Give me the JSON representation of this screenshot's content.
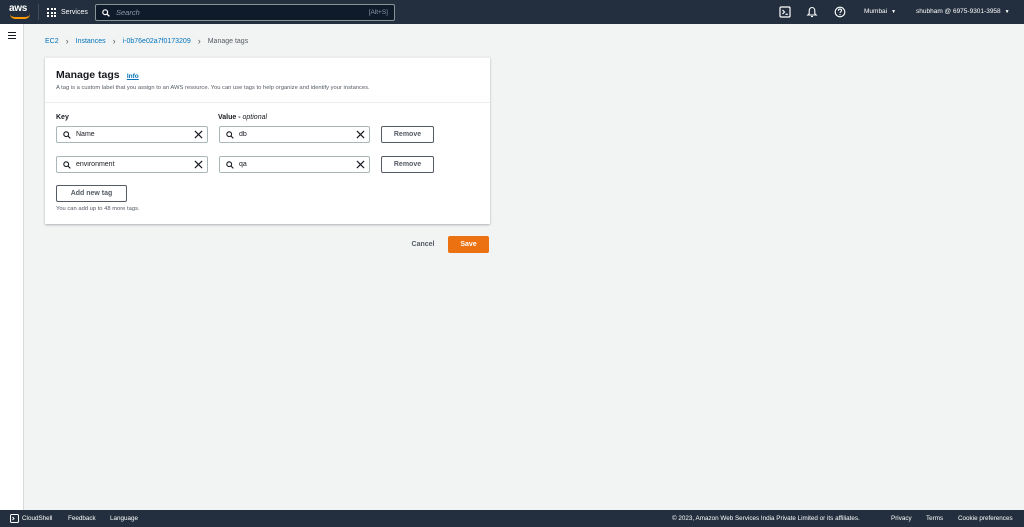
{
  "nav": {
    "logo": "aws",
    "services_label": "Services",
    "search_placeholder": "Search",
    "search_shortcut": "[Alt+S]",
    "region": "Mumbai",
    "account": "shubham @ 6975-9301-3958",
    "icons": [
      "cloudshell-icon",
      "bell-icon",
      "help-icon"
    ]
  },
  "breadcrumb": {
    "items": [
      "EC2",
      "Instances",
      "i-0b76e02a7f0173209"
    ],
    "current": "Manage tags"
  },
  "panel": {
    "title": "Manage tags",
    "info": "Info",
    "description": "A tag is a custom label that you assign to an AWS resource. You can use tags to help organize and identify your instances.",
    "key_label": "Key",
    "value_label": "Value - ",
    "value_optional": "optional",
    "tags": [
      {
        "key": "Name",
        "value": "db",
        "remove_label": "Remove"
      },
      {
        "key": "environment",
        "value": "qa",
        "remove_label": "Remove"
      }
    ],
    "add_label": "Add new tag",
    "hint": "You can add up to 48 more tags."
  },
  "actions": {
    "cancel": "Cancel",
    "save": "Save",
    "save_color": "#ec7211"
  },
  "footer": {
    "cloudshell": "CloudShell",
    "feedback": "Feedback",
    "language": "Language",
    "copyright": "© 2023, Amazon Web Services India Private Limited or its affiliates.",
    "privacy": "Privacy",
    "terms": "Terms",
    "cookie": "Cookie preferences"
  }
}
